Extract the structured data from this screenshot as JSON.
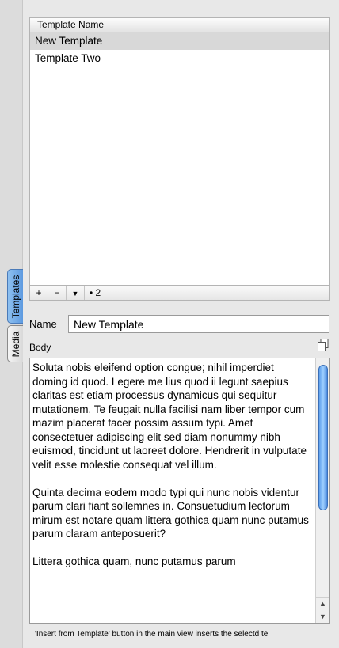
{
  "side_tabs": [
    "Templates",
    "Media"
  ],
  "table": {
    "header": "Template Name",
    "rows": [
      "New Template",
      "Template Two"
    ],
    "selected_index": 0
  },
  "footer": {
    "add": "+",
    "remove": "−",
    "menu_arrow": "▼",
    "count": "• 2"
  },
  "name_label": "Name",
  "name_value": "New Template",
  "body_label": "Body",
  "body_text": "Soluta nobis eleifend option congue; nihil imperdiet doming id quod. Legere me lius quod ii legunt saepius claritas est etiam processus dynamicus qui sequitur mutationem. Te feugait nulla facilisi nam liber tempor cum mazim placerat facer possim assum typi. Amet consectetuer adipiscing elit sed diam nonummy nibh euismod, tincidunt ut laoreet dolore. Hendrerit in vulputate velit esse molestie consequat vel illum.\n\nQuinta decima eodem modo typi qui nunc nobis videntur parum clari fiant sollemnes in. Consuetudium lectorum mirum est notare quam littera gothica quam nunc putamus parum claram anteposuerit?\n\nLittera gothica quam, nunc putamus parum",
  "scroll_up": "▲",
  "scroll_down": "▼",
  "status_text": "'Insert from Template' button in the main view inserts the selectd te",
  "colors": {
    "accent": "#5d9ae0",
    "selection": "#d8d8d8"
  },
  "icons": {
    "copy": "copy-icon"
  }
}
